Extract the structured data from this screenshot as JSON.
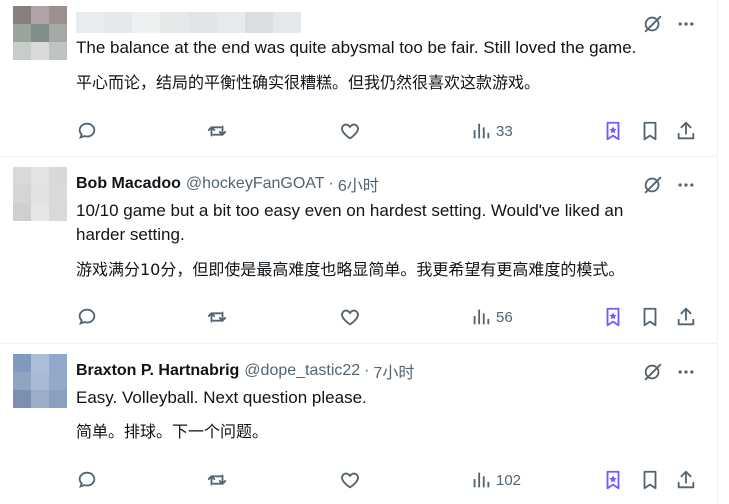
{
  "tweets": [
    {
      "name": "",
      "handle": "",
      "time": "",
      "text_en": "The balance at the end was quite abysmal too be fair. Still loved the game.",
      "text_cn": "平心而论，结局的平衡性确实很糟糕。但我仍然很喜欢这款游戏。",
      "views": "33",
      "avatar_colors": [
        "#8a7f7f",
        "#b0a3a6",
        "#9c8f90",
        "#9aa39c",
        "#7f8f87",
        "#a3aaa5",
        "#c9cdca",
        "#d8dbd9",
        "#bfc4c1"
      ]
    },
    {
      "name": "Bob Macadoo",
      "handle": "@hockeyFanGOAT",
      "time": "6小时",
      "text_en": "10/10 game but a bit too easy even on hardest setting. Would've liked an harder setting.",
      "text_cn": "游戏满分10分，但即使是最高难度也略显简单。我更希望有更高难度的模式。",
      "views": "56",
      "avatar_colors": [
        "#dad9d9",
        "#e4e3e3",
        "#d8d8d8",
        "#d5d5d5",
        "#e1e1e1",
        "#dadada",
        "#cfcfcf",
        "#e6e6e6",
        "#d9d9d9"
      ]
    },
    {
      "name": "Braxton P. Hartnabrig",
      "handle": "@dope_tastic22",
      "time": "7小时",
      "text_en": "Easy. Volleyball. Next question please.",
      "text_cn": "简单。排球。下一个问题。",
      "views": "102",
      "avatar_colors": [
        "#7f99bf",
        "#a9bfd9",
        "#8ea9cb",
        "#8fa4c3",
        "#a8bad4",
        "#93a8c6",
        "#7d8fb0",
        "#9aaec9",
        "#8aa0be"
      ]
    }
  ],
  "blurred_name_colors": [
    "#e9ecee",
    "#e5e9ec",
    "#eef1f2",
    "#e3e8e8",
    "#dfe4e6",
    "#e6eaec",
    "#d9dfe1",
    "#e4e8ea"
  ],
  "colors": {
    "text": "#0f1419",
    "secondary": "#536471",
    "grok_purple": "#7856ff",
    "divider": "#eff3f4"
  },
  "icons": {
    "top": [
      "grok-icon",
      "more-icon"
    ],
    "actions": [
      "reply-icon",
      "retweet-icon",
      "like-icon",
      "views-icon",
      "grok-bookmark-icon",
      "bookmark-icon",
      "share-icon"
    ]
  }
}
